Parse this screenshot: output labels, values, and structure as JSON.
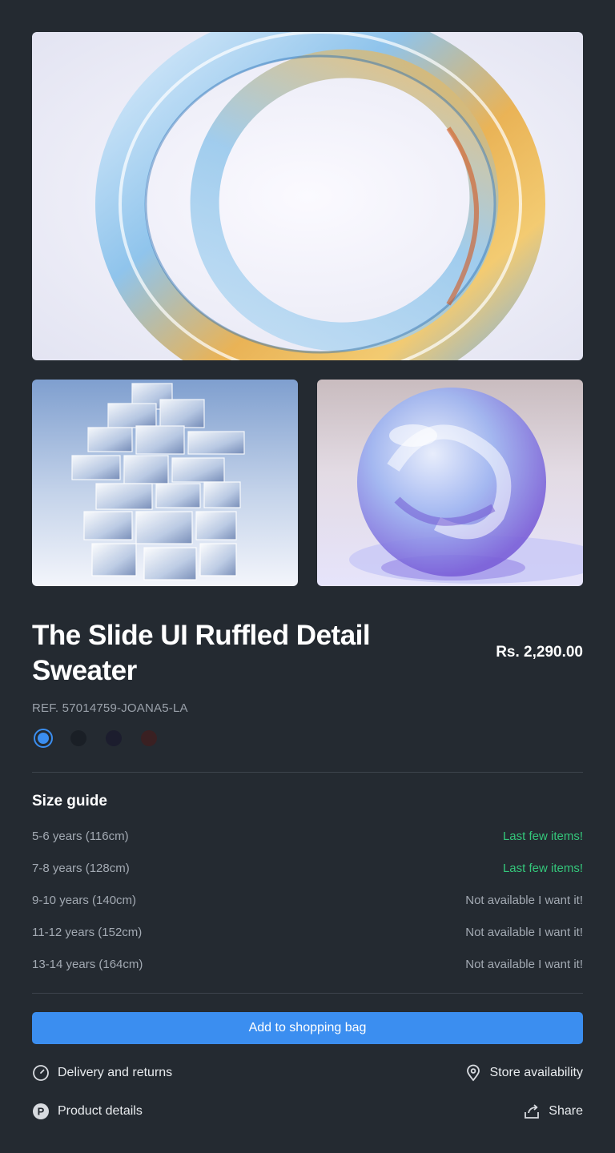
{
  "product": {
    "title": "The Slide UI Ruffled Detail Sweater",
    "price": "Rs. 2,290.00",
    "ref": "REF. 57014759-JOANA5-LA",
    "colors": [
      "#3b8ef0",
      "#1a1f26",
      "#1c1d2e",
      "#3a2022"
    ]
  },
  "images": {
    "hero": "glass-ring-image",
    "thumb1": "glass-cubes-image",
    "thumb2": "glass-sphere-image"
  },
  "size_guide": {
    "title": "Size guide",
    "rows": [
      {
        "label": "5-6 years (116cm)",
        "status": "Last few items!"
      },
      {
        "label": "7-8 years (128cm)",
        "status": "Last few items!"
      },
      {
        "label": "9-10 years (140cm)",
        "status": "Not available I want it!"
      },
      {
        "label": "11-12 years (152cm)",
        "status": "Not available I want it!"
      },
      {
        "label": "13-14 years (164cm)",
        "status": "Not available I want it!"
      }
    ]
  },
  "actions": {
    "add_to_bag": "Add to shopping bag",
    "delivery": "Delivery and returns",
    "store": "Store availability",
    "details": "Product details",
    "share": "Share"
  }
}
